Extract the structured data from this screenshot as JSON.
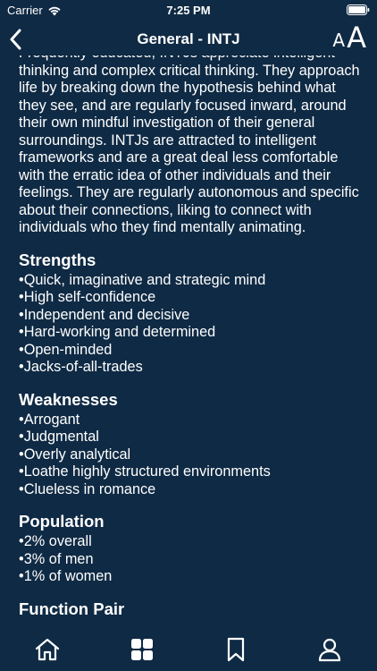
{
  "status_bar": {
    "carrier": "Carrier",
    "time": "7:25 PM"
  },
  "nav": {
    "title": "General - INTJ",
    "font_small": "A",
    "font_large": "A"
  },
  "content": {
    "intro_partial": "Frequently educated, INTJs appreciate intelligent thinking and complex critical thinking. They approach life by breaking down the hypothesis behind what they see, and are regularly focused inward, around their own mindful investigation of their general surroundings. INTJs are attracted to intelligent frameworks and are a great deal less comfortable with the erratic idea of other individuals and their feelings. They are regularly autonomous and specific about their connections, liking to connect with individuals who they find mentally animating.",
    "sections": [
      {
        "heading": "Strengths",
        "items": [
          "Quick, imaginative and strategic mind",
          "High self-confidence",
          "Independent and decisive",
          "Hard-working and determined",
          "Open-minded",
          "Jacks-of-all-trades"
        ]
      },
      {
        "heading": "Weaknesses",
        "items": [
          "Arrogant",
          "Judgmental",
          "Overly analytical",
          "Loathe highly structured environments",
          "Clueless in romance"
        ]
      },
      {
        "heading": "Population",
        "items": [
          "2% overall",
          "3% of men",
          "1% of women"
        ]
      },
      {
        "heading": "Function Pair",
        "items": []
      }
    ]
  },
  "tabs": [
    {
      "icon": "home-icon"
    },
    {
      "icon": "grid-icon"
    },
    {
      "icon": "bookmark-icon"
    },
    {
      "icon": "profile-icon"
    }
  ],
  "colors": {
    "background": "#0f2a44",
    "text": "#ffffff"
  }
}
